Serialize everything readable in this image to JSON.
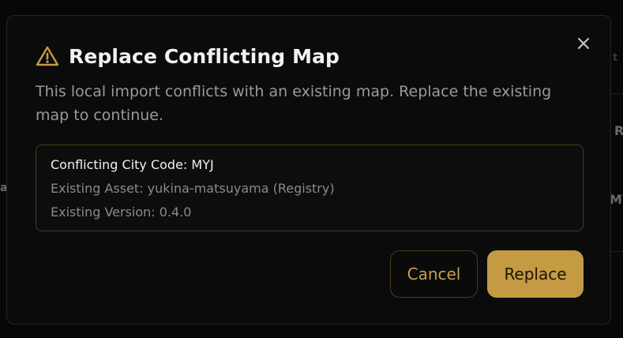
{
  "dialog": {
    "title": "Replace Conflicting Map",
    "description": "This local import conflicts with an existing map. Replace the existing map to continue.",
    "details": {
      "city_code": "Conflicting City Code: MYJ",
      "asset": "Existing Asset: yukina-matsuyama (Registry)",
      "version": "Existing Version: 0.4.0"
    },
    "buttons": {
      "cancel": "Cancel",
      "replace": "Replace"
    },
    "icons": {
      "title_icon": "warning-triangle-icon",
      "close_icon": "close-icon"
    }
  },
  "background": {
    "fragments": [
      "R",
      "a",
      "MY",
      "t"
    ]
  },
  "colors": {
    "accent": "#c49a42",
    "accent_border": "#4a3a1a",
    "modal_bg": "#0b0b0b",
    "page_bg": "#070707"
  }
}
